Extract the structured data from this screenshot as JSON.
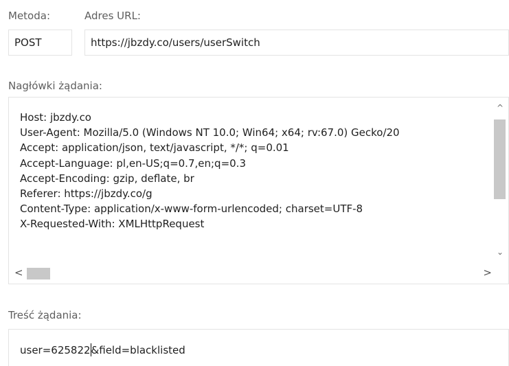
{
  "request": {
    "method_label": "Metoda:",
    "method_value": "POST",
    "url_label": "Adres URL:",
    "url_value": "https://jbzdy.co/users/userSwitch",
    "headers_label": "Nagłówki żądania:",
    "headers": [
      "Host: jbzdy.co",
      "User-Agent: Mozilla/5.0 (Windows NT 10.0; Win64; x64; rv:67.0) Gecko/20",
      "Accept: application/json, text/javascript, */*; q=0.01",
      "Accept-Language: pl,en-US;q=0.7,en;q=0.3",
      "Accept-Encoding: gzip, deflate, br",
      "Referer: https://jbzdy.co/g",
      "Content-Type: application/x-www-form-urlencoded; charset=UTF-8",
      "X-Requested-With: XMLHttpRequest"
    ],
    "body_label": "Treść żądania:",
    "body_before_caret": "user=625822",
    "body_after_caret": "&field=blacklisted"
  },
  "scrollbars": {
    "up_icon": "chevron-up-icon",
    "down_icon": "chevron-down-icon",
    "left_icon": "chevron-left-icon",
    "right_icon": "chevron-right-icon"
  }
}
